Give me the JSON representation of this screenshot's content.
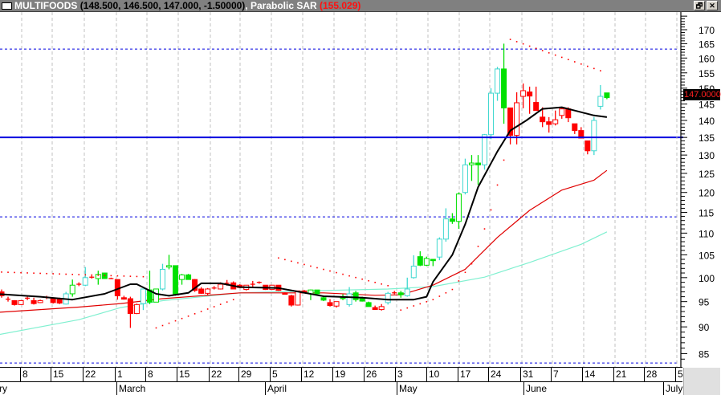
{
  "title": {
    "symbol": "MULTIFOODS",
    "values": "(148.500, 146.500, 147.000, -1.50000)",
    "separator": ",",
    "indicator": "Parabolic SAR",
    "indicator_value": "(155.029)"
  },
  "window_buttons": {
    "restore": "🗗",
    "close": "✕"
  },
  "last_price_label": "147.0000",
  "colors": {
    "up_hollow": "#40d8d0",
    "green": "#00e000",
    "red": "#ff0000",
    "ma_short": "#000000",
    "ma_mid": "#e00000",
    "ma_long": "#80f0d0",
    "hline": "#0000e0"
  },
  "chart_data": {
    "type": "candlestick",
    "title": "MULTIFOODS",
    "scale": "log",
    "ylim": [
      82,
      176
    ],
    "y_ticks": [
      170,
      165,
      160,
      155,
      150,
      145,
      140,
      135,
      130,
      125,
      120,
      115,
      110,
      105,
      100,
      95,
      90,
      85
    ],
    "x_day_labels": [
      "8",
      "15",
      "22",
      "1",
      "8",
      "15",
      "22",
      "29",
      "5",
      "12",
      "19",
      "26",
      "3",
      "10",
      "17",
      "24",
      "31",
      "7",
      "14",
      "21",
      "28",
      "5"
    ],
    "x_month_labels": [
      "February",
      "March",
      "April",
      "May",
      "June",
      "July"
    ],
    "candles": [
      [
        97,
        97.5,
        95.8,
        96.2,
        "R"
      ],
      [
        95.6,
        96,
        95,
        95.5,
        "x"
      ],
      [
        95.2,
        95.3,
        94.2,
        94.4,
        "R"
      ],
      [
        94.4,
        95.3,
        94.3,
        95.2,
        "r"
      ],
      [
        95.6,
        96,
        95.3,
        95.7,
        "x"
      ],
      [
        95.2,
        95.8,
        94.4,
        94.6,
        "R"
      ],
      [
        94.8,
        95.4,
        94.7,
        95.2,
        "r"
      ],
      [
        95.8,
        96.2,
        95.5,
        95.9,
        "x"
      ],
      [
        95.6,
        95.8,
        94.6,
        94.8,
        "R"
      ],
      [
        95.6,
        95.8,
        94.5,
        94.7,
        "R"
      ],
      [
        94.5,
        97,
        94.4,
        96.6,
        "C"
      ],
      [
        96.6,
        99.6,
        96,
        98.4,
        "g"
      ],
      [
        98.5,
        99,
        98.2,
        98.6,
        "x"
      ],
      [
        98.4,
        102.3,
        98.2,
        100,
        "C"
      ],
      [
        100.2,
        100.4,
        99.8,
        100.1,
        "x"
      ],
      [
        99.8,
        101.5,
        98.5,
        100.7,
        "g"
      ],
      [
        101,
        101,
        99.8,
        99.8,
        "G"
      ],
      [
        99.8,
        100,
        99.7,
        99.8,
        "x"
      ],
      [
        99.6,
        99.6,
        95.4,
        96.2,
        "R"
      ],
      [
        95.8,
        96.2,
        95.4,
        95.5,
        "R"
      ],
      [
        95.6,
        96,
        89.8,
        92.6,
        "R"
      ],
      [
        92.6,
        94.6,
        92.5,
        94.4,
        "r"
      ],
      [
        94.6,
        96.8,
        93.3,
        97.6,
        "C"
      ],
      [
        97.4,
        101.5,
        94.5,
        94.9,
        "G"
      ],
      [
        94.9,
        97.6,
        94.9,
        97.6,
        "g"
      ],
      [
        97.6,
        103,
        97.3,
        101.8,
        "C"
      ],
      [
        102.3,
        105,
        101.8,
        102.6,
        "g"
      ],
      [
        102.6,
        102.6,
        96.2,
        96.6,
        "G"
      ],
      [
        99.6,
        100.8,
        98.5,
        100.6,
        "g"
      ],
      [
        100.6,
        100.8,
        99.6,
        99.6,
        "G"
      ],
      [
        99.6,
        99.7,
        97,
        97.3,
        "R"
      ],
      [
        97.6,
        98,
        96.6,
        96.7,
        "R"
      ],
      [
        96.7,
        97.8,
        96.3,
        97.6,
        "r"
      ],
      [
        97.8,
        98.2,
        97.5,
        97.8,
        "x"
      ],
      [
        97.6,
        99,
        97.5,
        98.6,
        "r"
      ],
      [
        98.8,
        99.5,
        98.3,
        98.8,
        "x"
      ],
      [
        98.9,
        99.2,
        97.6,
        97.6,
        "R"
      ],
      [
        98.4,
        98.6,
        97.8,
        97.9,
        "R"
      ],
      [
        97.5,
        98.4,
        97.3,
        98.4,
        "r"
      ],
      [
        98.6,
        99.3,
        98,
        98.6,
        "x"
      ],
      [
        99,
        99.2,
        98.7,
        99,
        "x"
      ],
      [
        98.4,
        98.4,
        97.4,
        97.5,
        "R"
      ],
      [
        97.5,
        98.4,
        97.4,
        98.4,
        "r"
      ],
      [
        98.4,
        98.4,
        97.2,
        97.3,
        "R"
      ],
      [
        96.8,
        96.9,
        96.5,
        96.5,
        "R"
      ],
      [
        96.2,
        96.4,
        94,
        94.3,
        "R"
      ],
      [
        94.3,
        97.2,
        94.2,
        97.2,
        "r"
      ],
      [
        97.2,
        97.4,
        96.9,
        97,
        "R"
      ],
      [
        96.6,
        97.5,
        95.3,
        97.4,
        "g"
      ],
      [
        97.4,
        97.4,
        96.5,
        96.6,
        "G"
      ],
      [
        95.8,
        96.2,
        95.1,
        95.3,
        "G"
      ],
      [
        94.8,
        95.5,
        94,
        94.2,
        "R"
      ],
      [
        94.1,
        95,
        93.8,
        95,
        "r"
      ],
      [
        96,
        96.5,
        95.3,
        95.6,
        "G"
      ],
      [
        94.4,
        98,
        94,
        96.6,
        "C"
      ],
      [
        96.8,
        97.2,
        95,
        95.4,
        "G"
      ],
      [
        95.6,
        96,
        95,
        95.1,
        "G"
      ],
      [
        94.8,
        95,
        94,
        94,
        "G"
      ],
      [
        93.8,
        94.2,
        93.4,
        93.4,
        "R"
      ],
      [
        93.4,
        94.5,
        93.2,
        94,
        "r"
      ],
      [
        94.8,
        97,
        94.4,
        96.7,
        "C"
      ],
      [
        96.8,
        97.2,
        96.5,
        96.8,
        "x"
      ],
      [
        96.8,
        97.2,
        95.8,
        96.4,
        "G"
      ],
      [
        96.2,
        100,
        96,
        97.6,
        "C"
      ],
      [
        100,
        104.9,
        99.8,
        102.5,
        "C"
      ],
      [
        104.6,
        105.8,
        102.5,
        102.7,
        "G"
      ],
      [
        102.7,
        104.6,
        102.5,
        104.2,
        "g"
      ],
      [
        104,
        104,
        102.5,
        103.7,
        "G"
      ],
      [
        104.5,
        109,
        103.8,
        108.6,
        "C"
      ],
      [
        108.6,
        116,
        108,
        113.4,
        "C"
      ],
      [
        113.4,
        114.8,
        112.2,
        112.8,
        "G"
      ],
      [
        112.8,
        120,
        111,
        119.6,
        "g"
      ],
      [
        120,
        129,
        119.5,
        127.3,
        "C"
      ],
      [
        127.3,
        130,
        123,
        127.8,
        "g"
      ],
      [
        127.8,
        130,
        122,
        127.3,
        "G"
      ],
      [
        127.3,
        136,
        126,
        135.8,
        "C"
      ],
      [
        135.8,
        150,
        134.5,
        148.4,
        "C"
      ],
      [
        148.4,
        157,
        146,
        156.3,
        "C"
      ],
      [
        156.3,
        165,
        139,
        143.8,
        "G"
      ],
      [
        143.8,
        143.8,
        133,
        135.6,
        "R"
      ],
      [
        135.6,
        148.7,
        133,
        145.4,
        "r"
      ],
      [
        147.4,
        151.5,
        143.7,
        149.2,
        "r"
      ],
      [
        148.8,
        150.5,
        142,
        147.5,
        "R"
      ],
      [
        145.5,
        150.5,
        143.5,
        143,
        "R"
      ],
      [
        141,
        144,
        138,
        139.6,
        "R"
      ],
      [
        139.6,
        141,
        136.4,
        138.8,
        "R"
      ],
      [
        139,
        143,
        138.5,
        140.2,
        "r"
      ],
      [
        141.5,
        144,
        140.5,
        143.5,
        "r"
      ],
      [
        143.5,
        144,
        139.5,
        140.8,
        "R"
      ],
      [
        139,
        139,
        136,
        137,
        "R"
      ],
      [
        137,
        138,
        134.7,
        134.8,
        "R"
      ],
      [
        134,
        134,
        130.2,
        131.2,
        "R"
      ],
      [
        131.2,
        141,
        130,
        140,
        "C"
      ],
      [
        144.3,
        151,
        143.3,
        147.4,
        "C"
      ],
      [
        148.5,
        148.5,
        146.5,
        147,
        "G"
      ]
    ],
    "ma_short": [
      [
        -1,
        96.6
      ],
      [
        6,
        96
      ],
      [
        11,
        95.4
      ],
      [
        16,
        96.6
      ],
      [
        20,
        98.6
      ],
      [
        21,
        98.6
      ],
      [
        24,
        96.6
      ],
      [
        26,
        96.2
      ],
      [
        29,
        96.8
      ],
      [
        31,
        98.8
      ],
      [
        34,
        98.8
      ],
      [
        37,
        98
      ],
      [
        43,
        97.8
      ],
      [
        50,
        96.1
      ],
      [
        56,
        95.8
      ],
      [
        60,
        95.4
      ],
      [
        64,
        95.4
      ],
      [
        66,
        96
      ],
      [
        67,
        99.1
      ],
      [
        70,
        105
      ],
      [
        72,
        112.1
      ],
      [
        74,
        121.4
      ],
      [
        77,
        131
      ],
      [
        79,
        137
      ],
      [
        81.5,
        140
      ],
      [
        84,
        143.5
      ],
      [
        87,
        144
      ],
      [
        89,
        143
      ],
      [
        92,
        141.5
      ],
      [
        94,
        141
      ]
    ],
    "ma_mid": [
      [
        -1,
        92.8
      ],
      [
        12,
        93.9
      ],
      [
        18.5,
        94.6
      ],
      [
        25,
        95.6
      ],
      [
        37,
        96.8
      ],
      [
        50,
        96.8
      ],
      [
        58,
        96.3
      ],
      [
        62,
        96.4
      ],
      [
        67,
        98.4
      ],
      [
        72,
        101.8
      ],
      [
        77,
        109
      ],
      [
        82,
        115.5
      ],
      [
        87,
        120.6
      ],
      [
        92,
        123.2
      ],
      [
        94,
        125.8
      ]
    ],
    "ma_long": [
      [
        -1,
        88.4
      ],
      [
        12,
        91.4
      ],
      [
        18.5,
        93.8
      ],
      [
        25,
        95.2
      ],
      [
        37,
        96.8
      ],
      [
        50,
        97.3
      ],
      [
        60,
        97.6
      ],
      [
        67,
        98.1
      ],
      [
        75,
        100.1
      ],
      [
        82,
        103.3
      ],
      [
        90,
        107.4
      ],
      [
        94,
        110.3
      ]
    ],
    "sar": [
      {
        "from": 0,
        "to": 22,
        "points": [
          [
            0,
            101.2
          ],
          [
            22,
            100.2
          ]
        ]
      },
      {
        "from": 24,
        "to": 36,
        "points": [
          [
            24,
            89.8
          ],
          [
            36,
            95.4
          ]
        ]
      },
      {
        "from": 43,
        "to": 60,
        "points": [
          [
            43,
            104.3
          ],
          [
            60,
            98.3
          ]
        ]
      },
      {
        "from": 62,
        "to": 78,
        "points": [
          [
            62,
            93.3
          ],
          [
            67,
            95.4
          ],
          [
            70,
            97.5
          ],
          [
            73,
            103
          ],
          [
            75,
            111
          ],
          [
            76,
            115.6
          ],
          [
            78,
            128.6
          ]
        ]
      },
      {
        "from": 79,
        "to": 93,
        "points": [
          [
            79,
            166.5
          ],
          [
            93,
            155.7
          ]
        ]
      }
    ],
    "horizontal_lines": [
      {
        "value": 135,
        "style": "solid"
      },
      {
        "value": 163.1,
        "style": "dashed"
      },
      {
        "value": 113.9,
        "style": "dashed"
      },
      {
        "value": 83.3,
        "style": "dashed"
      }
    ]
  }
}
